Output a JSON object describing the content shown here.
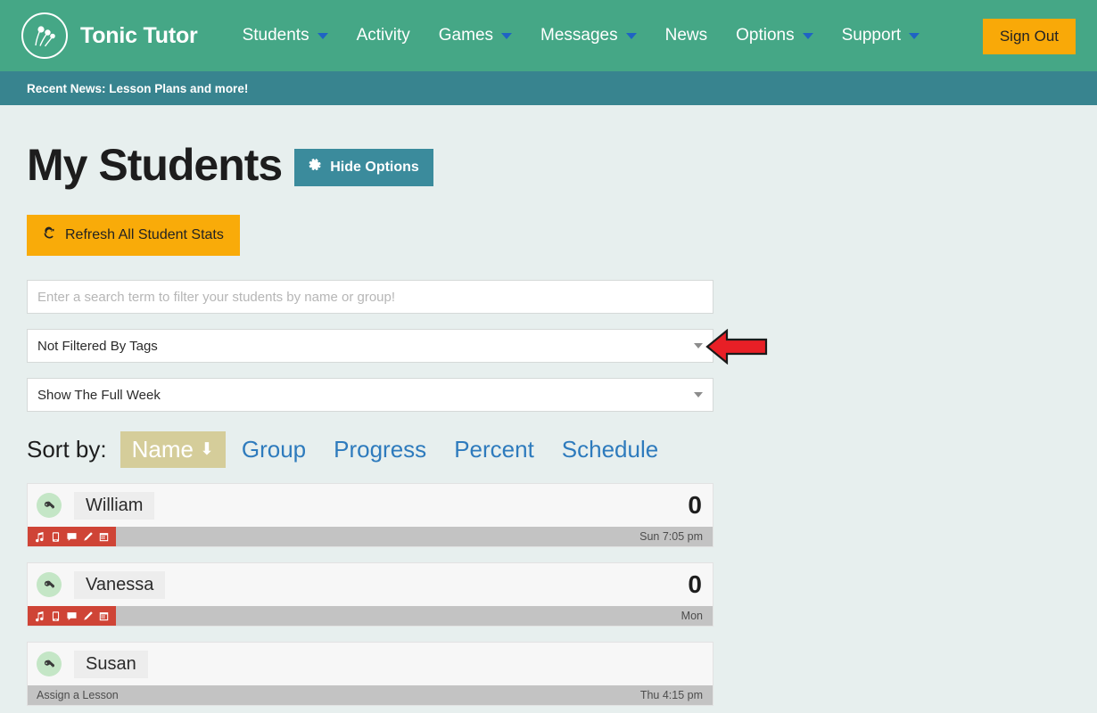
{
  "navbar": {
    "logo_icon": "tonic-tutor-logo",
    "brand": "Tonic Tutor",
    "items": [
      {
        "label": "Students",
        "has_caret": true
      },
      {
        "label": "Activity",
        "has_caret": false
      },
      {
        "label": "Games",
        "has_caret": true
      },
      {
        "label": "Messages",
        "has_caret": true
      },
      {
        "label": "News",
        "has_caret": false
      },
      {
        "label": "Options",
        "has_caret": true
      },
      {
        "label": "Support",
        "has_caret": true
      }
    ],
    "sign_out": "Sign Out",
    "bg_color": "#45a786",
    "signout_color": "#f9a908",
    "caret_color": "#1f63c4"
  },
  "newsbar": {
    "text": "Recent News: Lesson Plans and more!",
    "bg_color": "#38848f"
  },
  "page": {
    "title": "My Students",
    "hide_options_label": "Hide Options",
    "hide_options_icon": "gear-icon",
    "hide_options_color": "#3b8b9c",
    "refresh_label": "Refresh All Student Stats",
    "refresh_icon": "refresh-icon",
    "refresh_color": "#f9ab09",
    "bg_color": "#e7efee"
  },
  "filters": {
    "search_placeholder": "Enter a search term to filter your students by name or group!",
    "search_value": "",
    "tags_select_value": "Not Filtered By Tags",
    "week_select_value": "Show The Full Week"
  },
  "sort": {
    "label": "Sort by:",
    "options": [
      {
        "label": "Name",
        "active": true,
        "arrow": "⬇"
      },
      {
        "label": "Group",
        "active": false
      },
      {
        "label": "Progress",
        "active": false
      },
      {
        "label": "Percent",
        "active": false
      },
      {
        "label": "Schedule",
        "active": false
      }
    ],
    "active_bg": "#d5cd9a",
    "link_color": "#2e7bbd"
  },
  "students": [
    {
      "name": "William",
      "count": "0",
      "timestamp": "Sun 7:05 pm",
      "has_actions": true,
      "assign_text": "",
      "actions": [
        "music-note-icon",
        "mobile-icon",
        "comment-icon",
        "pencil-icon",
        "calendar-icon"
      ]
    },
    {
      "name": "Vanessa",
      "count": "0",
      "timestamp": "Mon",
      "has_actions": true,
      "assign_text": "",
      "actions": [
        "music-note-icon",
        "mobile-icon",
        "comment-icon",
        "pencil-icon",
        "calendar-icon"
      ]
    },
    {
      "name": "Susan",
      "count": "",
      "timestamp": "Thu 4:15 pm",
      "has_actions": false,
      "assign_text": "Assign a Lesson",
      "actions": []
    }
  ],
  "annotation": {
    "arrow_icon": "left-arrow-annotation",
    "arrow_color": "#e81f26",
    "points_at": "tags-filter-select"
  }
}
